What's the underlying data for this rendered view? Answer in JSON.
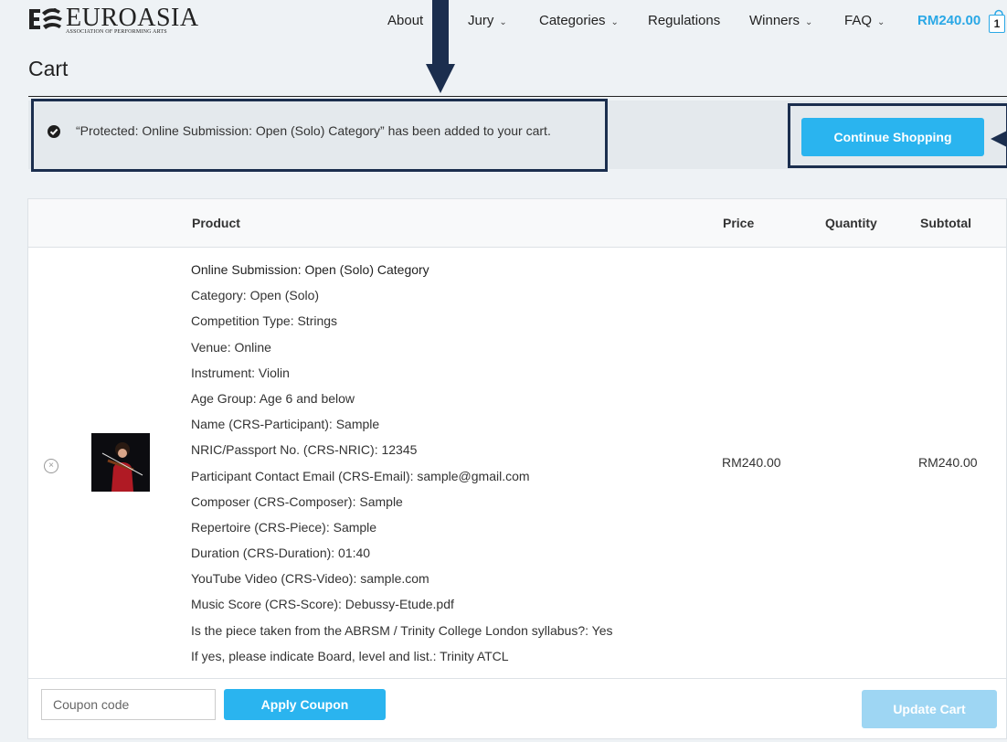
{
  "header": {
    "logo_name": "EUROASIA",
    "logo_subtitle": "ASSOCIATION OF PERFORMING ARTS",
    "nav": [
      {
        "label": "About",
        "dropdown": false
      },
      {
        "label": "Jury",
        "dropdown": true
      },
      {
        "label": "Categories",
        "dropdown": true
      },
      {
        "label": "Regulations",
        "dropdown": false
      },
      {
        "label": "Winners",
        "dropdown": true
      },
      {
        "label": "FAQ",
        "dropdown": true
      }
    ],
    "cart_total": "RM240.00",
    "cart_count": "1",
    "chevron": "⌄"
  },
  "page": {
    "title": "Cart"
  },
  "notice": {
    "message": "“Protected: Online Submission: Open (Solo) Category” has been added to your cart.",
    "button": "Continue Shopping"
  },
  "table": {
    "headers": {
      "product": "Product",
      "price": "Price",
      "quantity": "Quantity",
      "subtotal": "Subtotal"
    },
    "row": {
      "remove_symbol": "×",
      "lines": [
        "Online Submission: Open (Solo) Category",
        "Category: Open (Solo)",
        "Competition Type: Strings",
        "Venue: Online",
        "Instrument: Violin",
        "Age Group: Age 6 and below",
        "Name (CRS-Participant): Sample",
        "NRIC/Passport No. (CRS-NRIC): 12345",
        "Participant Contact Email (CRS-Email): sample@gmail.com",
        "Composer (CRS-Composer): Sample",
        "Repertoire (CRS-Piece): Sample",
        "Duration (CRS-Duration): 01:40",
        "YouTube Video (CRS-Video): sample.com",
        "Music Score (CRS-Score): Debussy-Etude.pdf",
        "Is the piece taken from the ABRSM / Trinity College London syllabus?: Yes",
        "If yes, please indicate Board, level and list.: Trinity ATCL"
      ],
      "price": "RM240.00",
      "subtotal": "RM240.00"
    }
  },
  "actions": {
    "coupon_placeholder": "Coupon code",
    "apply_coupon": "Apply Coupon",
    "update_cart": "Update Cart"
  },
  "colors": {
    "accent": "#2ab4ef",
    "callout": "#1b2e4e",
    "disabled": "#9ed6f3"
  }
}
